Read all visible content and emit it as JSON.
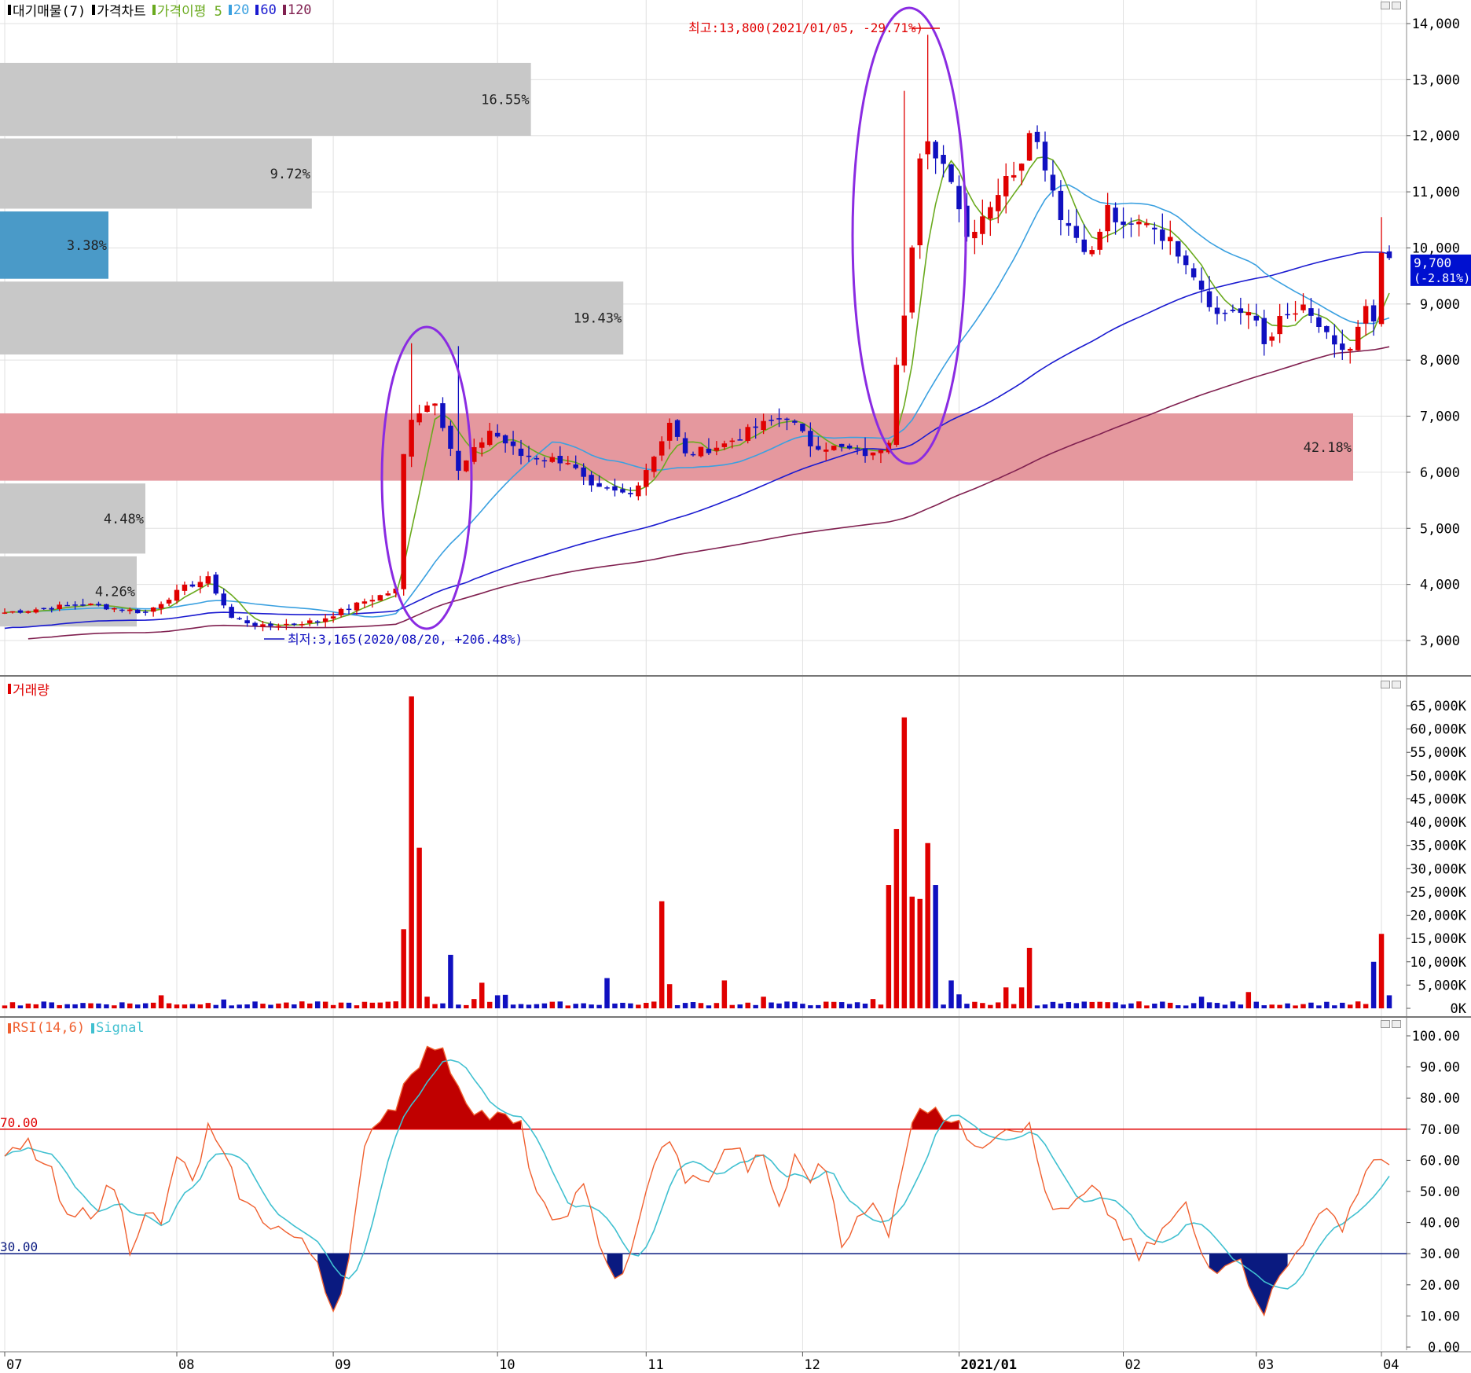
{
  "colors": {
    "up": "#e00000",
    "down": "#1010c0",
    "ma5": "#6aaa1e",
    "ma20": "#3aa0e0",
    "ma60": "#1a1ad0",
    "ma120": "#802050",
    "ellipse": "#8a2be2",
    "vol_bar_gray": "#c8c8c8",
    "vol_bar_blue": "#4a9ac8",
    "vol_bar_pink": "#e5989e",
    "rsi": "#f06030",
    "signal": "#40c0d0",
    "rsi_over": "#c00000",
    "rsi_under": "#0a1a80",
    "grid": "#e0e0e0"
  },
  "legend_price": [
    {
      "label": "대기매물(7)",
      "color": "#000000"
    },
    {
      "label": "가격차트",
      "color": "#000000"
    },
    {
      "label": "가격이평 5",
      "color": "#6aaa1e"
    },
    {
      "label": "20",
      "color": "#3aa0e0"
    },
    {
      "label": "60",
      "color": "#1a1ad0"
    },
    {
      "label": "120",
      "color": "#802050"
    }
  ],
  "legend_volume": [
    {
      "label": "거래량",
      "color": "#e00000"
    }
  ],
  "legend_rsi": [
    {
      "label": "RSI(14,6)",
      "color": "#f06030"
    },
    {
      "label": "Signal",
      "color": "#40c0d0"
    }
  ],
  "x_axis_labels": [
    "07",
    "08",
    "09",
    "10",
    "11",
    "12",
    "2021/01",
    "02",
    "03",
    "04"
  ],
  "chart_data": [
    {
      "type": "candlestick",
      "ylim": [
        2500,
        14300
      ],
      "y_ticks": [
        "3,000",
        "4,000",
        "5,000",
        "6,000",
        "7,000",
        "8,000",
        "9,000",
        "10,000",
        "11,000",
        "12,000",
        "13,000",
        "14,000"
      ],
      "last_price_label": "9,700",
      "last_change_label": "(-2.81%)",
      "last_price": 9700,
      "annotation_high": {
        "text": "최고:13,800(2021/01/05, -29.71%)",
        "value": 13800
      },
      "annotation_low": {
        "text": "최저:3,165(2020/08/20, +206.48%)",
        "value": 3165
      },
      "volume_profile": [
        {
          "label": "16.55%",
          "low": 12000,
          "high": 13300,
          "pct": 16.55
        },
        {
          "label": "9.72%",
          "low": 10700,
          "high": 11950,
          "pct": 9.72
        },
        {
          "label": "3.38%",
          "low": 9450,
          "high": 10650,
          "pct": 3.38,
          "highlight": "blue"
        },
        {
          "label": "19.43%",
          "low": 8100,
          "high": 9400,
          "pct": 19.43
        },
        {
          "label": "42.18%",
          "low": 5850,
          "high": 7050,
          "pct": 42.18,
          "highlight": "pink"
        },
        {
          "label": "4.48%",
          "low": 4550,
          "high": 5800,
          "pct": 4.48
        },
        {
          "label": "4.26%",
          "low": 3250,
          "high": 4500,
          "pct": 4.26
        }
      ],
      "anchors": [
        [
          0,
          3500
        ],
        [
          10,
          3650
        ],
        [
          18,
          3500
        ],
        [
          23,
          3950
        ],
        [
          26,
          4100
        ],
        [
          29,
          3400
        ],
        [
          33,
          3250
        ],
        [
          40,
          3350
        ],
        [
          46,
          3700
        ],
        [
          50,
          3900
        ],
        [
          51,
          6300
        ],
        [
          52,
          7000
        ],
        [
          55,
          7300
        ],
        [
          58,
          6000
        ],
        [
          62,
          6750
        ],
        [
          66,
          6300
        ],
        [
          72,
          6200
        ],
        [
          75,
          5700
        ],
        [
          80,
          5600
        ],
        [
          83,
          6300
        ],
        [
          85,
          6900
        ],
        [
          87,
          6300
        ],
        [
          92,
          6500
        ],
        [
          96,
          6800
        ],
        [
          100,
          7000
        ],
        [
          103,
          6500
        ],
        [
          108,
          6400
        ],
        [
          111,
          6300
        ],
        [
          113,
          6600
        ],
        [
          114,
          8000
        ],
        [
          115,
          8900
        ],
        [
          116,
          10000
        ],
        [
          117,
          11500
        ],
        [
          118,
          11800
        ],
        [
          119,
          11700
        ],
        [
          121,
          11300
        ],
        [
          123,
          10200
        ],
        [
          127,
          11000
        ],
        [
          130,
          11600
        ],
        [
          131,
          12200
        ],
        [
          133,
          11500
        ],
        [
          135,
          10600
        ],
        [
          137,
          10200
        ],
        [
          139,
          9900
        ],
        [
          141,
          10700
        ],
        [
          143,
          10300
        ],
        [
          146,
          10500
        ],
        [
          149,
          10100
        ],
        [
          151,
          9800
        ],
        [
          153,
          9300
        ],
        [
          155,
          8800
        ],
        [
          157,
          8900
        ],
        [
          160,
          8700
        ],
        [
          161,
          8300
        ],
        [
          163,
          8700
        ],
        [
          166,
          8900
        ],
        [
          168,
          8600
        ],
        [
          170,
          8200
        ],
        [
          172,
          8200
        ],
        [
          174,
          8900
        ],
        [
          175,
          8600
        ],
        [
          176,
          9900
        ],
        [
          177,
          9700
        ]
      ]
    },
    {
      "type": "bar",
      "title": "거래량",
      "ylim": [
        0,
        68000
      ],
      "y_ticks": [
        "0K",
        "5,000K",
        "10,000K",
        "15,000K",
        "20,000K",
        "25,000K",
        "30,000K",
        "35,000K",
        "40,000K",
        "45,000K",
        "50,000K",
        "55,000K",
        "60,000K",
        "65,000K"
      ],
      "spikes": [
        [
          20,
          2800
        ],
        [
          28,
          1900
        ],
        [
          50,
          1500
        ],
        [
          51,
          17000
        ],
        [
          52,
          67000
        ],
        [
          53,
          34500
        ],
        [
          54,
          2500
        ],
        [
          57,
          11500
        ],
        [
          60,
          2000
        ],
        [
          61,
          5500
        ],
        [
          63,
          2800
        ],
        [
          64,
          2900
        ],
        [
          77,
          6500
        ],
        [
          84,
          23000
        ],
        [
          85,
          5200
        ],
        [
          92,
          6000
        ],
        [
          97,
          2500
        ],
        [
          111,
          2000
        ],
        [
          113,
          26500
        ],
        [
          114,
          38500
        ],
        [
          115,
          62500
        ],
        [
          116,
          24000
        ],
        [
          117,
          23500
        ],
        [
          118,
          35500
        ],
        [
          119,
          26500
        ],
        [
          121,
          6000
        ],
        [
          122,
          3000
        ],
        [
          128,
          4500
        ],
        [
          130,
          4500
        ],
        [
          131,
          13000
        ],
        [
          153,
          2500
        ],
        [
          159,
          3500
        ],
        [
          175,
          10000
        ],
        [
          176,
          16000
        ],
        [
          177,
          2800
        ]
      ]
    },
    {
      "type": "line",
      "title": "RSI(14,6)",
      "ylim": [
        0,
        100
      ],
      "y_ticks": [
        "0.00",
        "10.00",
        "20.00",
        "30.00",
        "40.00",
        "50.00",
        "60.00",
        "70.00",
        "80.00",
        "90.00",
        "100.00"
      ],
      "ref_lines": [
        {
          "label": "70.00",
          "value": 70
        },
        {
          "label": "30.00",
          "value": 30
        }
      ],
      "rsi_anchors": [
        [
          0,
          60
        ],
        [
          3,
          65
        ],
        [
          6,
          55
        ],
        [
          8,
          40
        ],
        [
          11,
          44
        ],
        [
          14,
          52
        ],
        [
          16,
          32
        ],
        [
          18,
          45
        ],
        [
          20,
          38
        ],
        [
          22,
          62
        ],
        [
          24,
          52
        ],
        [
          26,
          70
        ],
        [
          28,
          60
        ],
        [
          31,
          45
        ],
        [
          34,
          40
        ],
        [
          37,
          35
        ],
        [
          40,
          28
        ],
        [
          42,
          12
        ],
        [
          44,
          28
        ],
        [
          46,
          62
        ],
        [
          48,
          75
        ],
        [
          50,
          78
        ],
        [
          52,
          90
        ],
        [
          55,
          97
        ],
        [
          57,
          90
        ],
        [
          59,
          80
        ],
        [
          61,
          75
        ],
        [
          64,
          73
        ],
        [
          66,
          70
        ],
        [
          68,
          50
        ],
        [
          70,
          38
        ],
        [
          72,
          45
        ],
        [
          74,
          50
        ],
        [
          76,
          35
        ],
        [
          78,
          22
        ],
        [
          80,
          28
        ],
        [
          83,
          60
        ],
        [
          85,
          65
        ],
        [
          87,
          55
        ],
        [
          89,
          52
        ],
        [
          93,
          65
        ],
        [
          95,
          58
        ],
        [
          97,
          60
        ],
        [
          99,
          45
        ],
        [
          101,
          60
        ],
        [
          103,
          55
        ],
        [
          105,
          58
        ],
        [
          107,
          35
        ],
        [
          109,
          40
        ],
        [
          111,
          45
        ],
        [
          113,
          38
        ],
        [
          115,
          62
        ],
        [
          117,
          78
        ],
        [
          119,
          78
        ],
        [
          121,
          72
        ],
        [
          123,
          68
        ],
        [
          125,
          66
        ],
        [
          127,
          70
        ],
        [
          129,
          72
        ],
        [
          131,
          70
        ],
        [
          133,
          50
        ],
        [
          135,
          42
        ],
        [
          137,
          46
        ],
        [
          139,
          50
        ],
        [
          141,
          44
        ],
        [
          143,
          36
        ],
        [
          145,
          28
        ],
        [
          147,
          34
        ],
        [
          149,
          40
        ],
        [
          151,
          45
        ],
        [
          153,
          30
        ],
        [
          155,
          26
        ],
        [
          157,
          30
        ],
        [
          159,
          22
        ],
        [
          161,
          12
        ],
        [
          163,
          22
        ],
        [
          165,
          30
        ],
        [
          167,
          40
        ],
        [
          169,
          42
        ],
        [
          171,
          40
        ],
        [
          173,
          50
        ],
        [
          175,
          62
        ],
        [
          177,
          56
        ]
      ]
    }
  ]
}
